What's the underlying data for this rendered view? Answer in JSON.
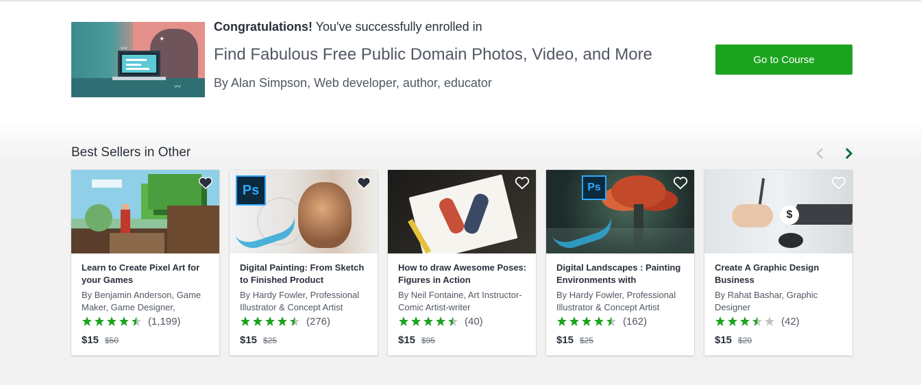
{
  "enrollment": {
    "congrats_bold": "Congratulations!",
    "congrats_rest": " You've successfully enrolled in",
    "course_title": "Find Fabulous Free Public Domain Photos, Video, and More",
    "course_author": "By Alan Simpson, Web developer, author, educator",
    "cta_label": "Go to Course",
    "cta_color": "#1ca31f"
  },
  "section": {
    "title": "Best Sellers in Other",
    "prev_icon": "chevron-left-icon",
    "next_icon": "chevron-right-icon"
  },
  "cards": [
    {
      "title": "Learn to Create Pixel Art for your Games",
      "author": "By Benjamin Anderson, Game Maker, Game Designer,",
      "rating": 4.5,
      "count": "(1,199)",
      "price": "$15",
      "original_price": "$50",
      "favorited": true
    },
    {
      "title": "Digital Painting: From Sketch to Finished Product",
      "author": "By Hardy Fowler, Professional Illustrator & Concept Artist",
      "rating": 4.5,
      "count": "(276)",
      "price": "$15",
      "original_price": "$25",
      "favorited": true,
      "badge": "Ps"
    },
    {
      "title": "How to draw Awesome Poses: Figures in Action",
      "author": "By Neil Fontaine, Art Instructor-Comic Artist-writer",
      "rating": 4.5,
      "count": "(40)",
      "price": "$15",
      "original_price": "$95",
      "favorited": false
    },
    {
      "title": "Digital Landscapes : Painting Environments with",
      "author": "By Hardy Fowler, Professional Illustrator & Concept Artist",
      "rating": 4.5,
      "count": "(162)",
      "price": "$15",
      "original_price": "$25",
      "favorited": false,
      "badge": "Ps"
    },
    {
      "title": "Create A Graphic Design Business",
      "author": "By Rahat Bashar, Graphic Designer",
      "rating": 3.5,
      "count": "(42)",
      "price": "$15",
      "original_price": "$20",
      "favorited": false
    }
  ],
  "colors": {
    "star": "#1ca31f",
    "star_empty": "#c4c4c4",
    "nav_active": "#0e6b3a",
    "nav_inactive": "#c7c7c7"
  }
}
